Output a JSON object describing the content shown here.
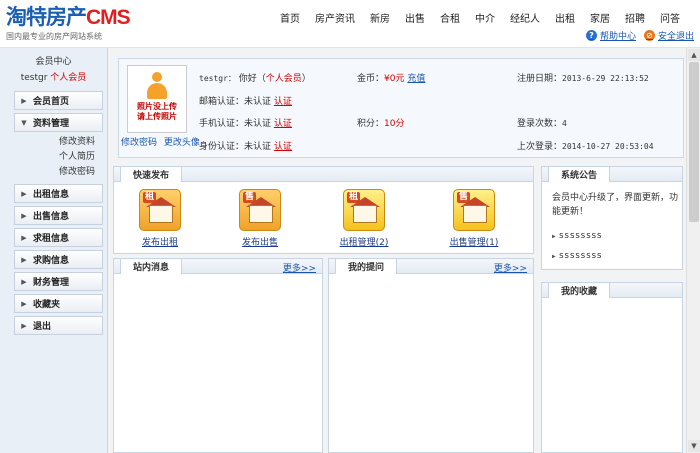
{
  "header": {
    "logo_cn": "淘特房产",
    "logo_en": "CMS",
    "logo_sub": "国内最专业的房产网站系统",
    "nav": [
      "首页",
      "房产资讯",
      "新房",
      "出售",
      "合租",
      "中介",
      "经纪人",
      "出租",
      "家居",
      "招聘",
      "问答"
    ],
    "help_label": "帮助中心",
    "logout_label": "安全退出",
    "help_icon": "?",
    "logout_icon": "⊘"
  },
  "sidebar": {
    "title": "会员中心",
    "username": "testgr",
    "role": "个人会员",
    "menu": [
      {
        "label": "会员首页",
        "icon": "▶"
      },
      {
        "label": "资料管理",
        "icon": "▼"
      },
      {
        "label": "出租信息",
        "icon": "▶"
      },
      {
        "label": "出售信息",
        "icon": "▶"
      },
      {
        "label": "求租信息",
        "icon": "▶"
      },
      {
        "label": "求购信息",
        "icon": "▶"
      },
      {
        "label": "财务管理",
        "icon": "▶"
      },
      {
        "label": "收藏夹",
        "icon": "▶"
      },
      {
        "label": "退出",
        "icon": "▶"
      }
    ],
    "submenu": [
      "修改资料",
      "个人简历",
      "修改密码"
    ]
  },
  "profile": {
    "photo_text_1": "照片没上传",
    "photo_text_2": "请上传照片",
    "change_password": "修改密码",
    "change_avatar": "更改头像",
    "user_label": "testgr：",
    "greeting": "你好（",
    "role": "个人会员",
    "greeting_end": "）",
    "coins_label": "金币：",
    "coins_value": "¥0元",
    "recharge": "充值",
    "reg_label": "注册日期：",
    "reg_date": "2013-6-29 22:13:52",
    "email_label": "邮箱认证：",
    "email_status": "未认证",
    "email_action": "认证",
    "phone_label": "手机认证：",
    "phone_status": "未认证",
    "phone_action": "认证",
    "points_label": "积分：",
    "points_value": "10分",
    "login_count_label": "登录次数：",
    "login_count": "4",
    "id_label": "身份认证：",
    "id_status": "未认证",
    "id_action": "认证",
    "last_login_label": "上次登录：",
    "last_login": "2014-10-27 20:53:04"
  },
  "quick_publish": {
    "title": "快速发布",
    "items": [
      {
        "label": "发布出租",
        "badge": "租"
      },
      {
        "label": "发布出售",
        "badge": "售"
      },
      {
        "label": "出租管理(2)",
        "badge": "租"
      },
      {
        "label": "出售管理(1)",
        "badge": "售"
      }
    ]
  },
  "announcement": {
    "title": "系统公告",
    "line1": "会员中心升级了，界面更新，功",
    "line2": "能更新！",
    "items": [
      "ssssssss",
      "ssssssss"
    ]
  },
  "messages": {
    "title": "站内消息",
    "more": "更多>>"
  },
  "questions": {
    "title": "我的提问",
    "more": "更多>>"
  },
  "favorites": {
    "title": "我的收藏"
  }
}
